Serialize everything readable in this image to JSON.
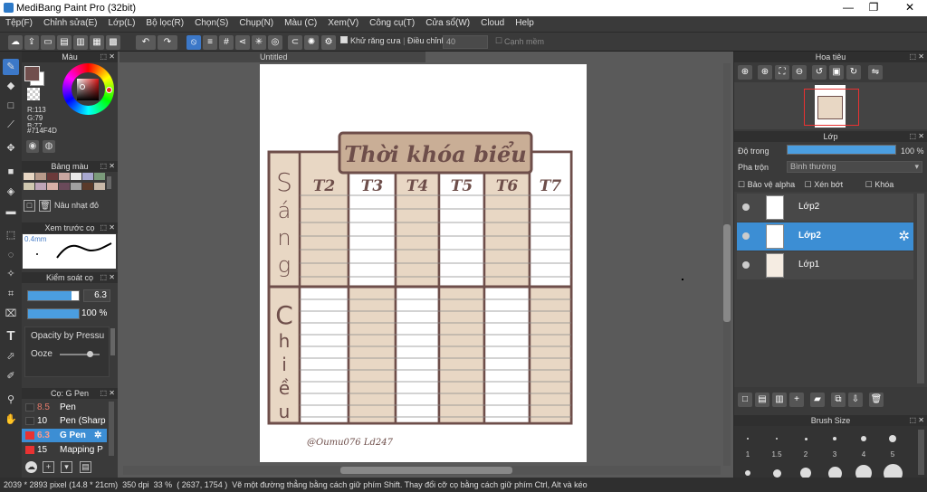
{
  "window": {
    "title": "MediBang Paint Pro (32bit)",
    "minimize": "—",
    "restore": "❐",
    "close": "✕"
  },
  "menu": [
    "Tệp(F)",
    "Chỉnh sửa(E)",
    "Lớp(L)",
    "Bộ lọc(R)",
    "Chọn(S)",
    "Chụp(N)",
    "Màu (C)",
    "Xem(V)",
    "Công cụ(T)",
    "Cửa sổ(W)",
    "Cloud",
    "Help"
  ],
  "toolbar": {
    "antialias_label": "Khử răng cưa",
    "correction_label": "Điều chỉnh",
    "correction_value": "40",
    "edge_label": "Cạnh mềm"
  },
  "color_panel": {
    "title": "Màu",
    "r": "R:113",
    "g": "G:79",
    "b": "B:77",
    "hex": "#714F4D",
    "primary_color": "#714F4D",
    "secondary_color": "#ffffff"
  },
  "palette_panel": {
    "title": "Bảng màu",
    "swatches": [
      "#e8d7c4",
      "#b89a8a",
      "#6b3a3a",
      "#c9a6a0",
      "#e8e8e8",
      "#a8a8d0",
      "#7a9a7a",
      "#d0c8b0",
      "#bfa5b8",
      "#d8b0a8",
      "#6a4a5a",
      "#a0a0a0",
      "#5a3a2a",
      "#c8b8a8"
    ],
    "selected_name": "Nâu nhạt đỏ"
  },
  "brush_preview_panel": {
    "title": "Xem trước cọ",
    "size_label": "0.4mm"
  },
  "brush_control_panel": {
    "title": "Kiểm soát cọ",
    "size_value": "6.3",
    "opacity_value": "100 %",
    "opacity_fill": 1.0,
    "size_fill": 0.85,
    "pressure_label": "Opacity by Pressu",
    "ooze_label": "Ooze"
  },
  "brush_list_panel": {
    "title": "Cọ: G Pen",
    "brushes": [
      {
        "size": "8.5",
        "name": "Pen",
        "color": "#ffffff",
        "size_color": "#e67a6a",
        "selected": false
      },
      {
        "size": "10",
        "name": "Pen (Sharp",
        "color": "#ffffff",
        "size_color": "#ffffff",
        "selected": false
      },
      {
        "size": "6.3",
        "name": "G Pen",
        "color": "#e83232",
        "size_color": "#ff8a7a",
        "selected": true
      },
      {
        "size": "15",
        "name": "Mapping P",
        "color": "#e83232",
        "size_color": "#ffffff",
        "selected": false
      }
    ]
  },
  "document": {
    "tab_title": "Untitled"
  },
  "artwork": {
    "title": "Thời khóa biểu",
    "days": [
      "T2",
      "T3",
      "T4",
      "T5",
      "T6",
      "T7"
    ],
    "morning_label": [
      "S",
      "á",
      "n",
      "g"
    ],
    "afternoon_label": [
      "C",
      "h",
      "i",
      "ề",
      "u"
    ],
    "signature": "@Oumu076 Ld247",
    "colors": {
      "frame": "#6e4e4a",
      "fill": "#e8d7c4",
      "title_fill": "#c9ae96",
      "line": "#8a8a8a"
    }
  },
  "navigator_panel": {
    "title": "Hoa tiêu"
  },
  "layer_panel": {
    "title": "Lớp",
    "opacity_label": "Độ trong",
    "opacity_value": "100 %",
    "blend_label": "Pha trộn",
    "blend_value": "Bình thường",
    "protect_alpha": "Bảo vệ alpha",
    "clipping": "Xén bớt",
    "lock": "Khóa",
    "layers": [
      {
        "name": "Lớp2",
        "selected": false
      },
      {
        "name": "Lớp2",
        "selected": true
      },
      {
        "name": "Lớp1",
        "selected": false
      }
    ]
  },
  "brush_size_panel": {
    "title": "Brush Size",
    "sizes": [
      "1",
      "1.5",
      "2",
      "3",
      "4",
      "5"
    ]
  },
  "status": {
    "dimensions": "2039 * 2893 pixel",
    "physical": "(14.8 * 21cm)",
    "dpi": "350 dpi",
    "zoom": "33 %",
    "coords": "( 2637, 1754 )",
    "hint": "Vẽ một đường thẳng bằng cách giữ phím Shift. Thay đổi cỡ cọ bằng cách giữ phím Ctrl, Alt và kéo"
  }
}
